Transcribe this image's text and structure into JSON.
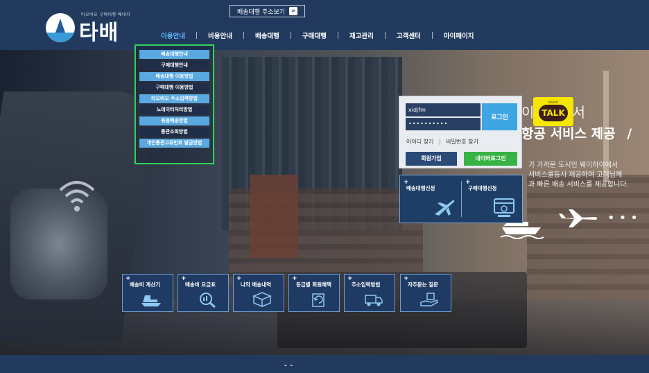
{
  "header": {
    "logo_tagline": "타오바오 구매대행 배대지",
    "logo_text": "타배",
    "address_button": "배송대행 주소보기",
    "nav": [
      "이용안내",
      "비용안내",
      "배송대행",
      "구매대행",
      "재고관리",
      "고객센터",
      "마이페이지"
    ]
  },
  "dropdown": {
    "items": [
      "배송대행안내",
      "구매대행안내",
      "배송대행 이용방법",
      "구매대행 이용방법",
      "타오바오 주소입력방법",
      "노데이터처리방법",
      "묶음배송방법",
      "통관조회방법",
      "개인통관고유번호 발급방법"
    ]
  },
  "kakao": {
    "small": "KAKAO",
    "label": "TALK",
    "color": "#f7e600"
  },
  "hero": {
    "line1": "이하이에서",
    "line2": "항공 서비스 제공",
    "line2_suffix": "/",
    "sub": [
      "가 가까운 도시인 웨이하이에서",
      "서비스를동시 제공하여 고객님께",
      "과 빠른 배송 서비스를 제공합니다."
    ]
  },
  "login": {
    "id_value": "xidjfm",
    "pw_value": "••••••••••",
    "login_button": "로그인",
    "find_id": "아이디 찾기",
    "separator": "|",
    "find_pw": "비밀번호 찾기",
    "join_button": "회원가입",
    "naver_button": "네이버로그인"
  },
  "service": {
    "shipping": "배송대행신청",
    "purchase": "구매대행신청"
  },
  "quick": [
    {
      "label": "배송비 계산기",
      "icon": "ship-icon"
    },
    {
      "label": "배송비 요금표",
      "icon": "magnifier-icon"
    },
    {
      "label": "나의 배송내역",
      "icon": "box-icon"
    },
    {
      "label": "등급별 회원혜택",
      "icon": "refresh-doc-icon"
    },
    {
      "label": "주소입력방법",
      "icon": "truck-icon"
    },
    {
      "label": "자주묻는 질문",
      "icon": "hand-box-icon"
    }
  ],
  "colors": {
    "header": "#223a5e",
    "active_nav": "#62b8ff",
    "dropdown_border": "#2fd35a",
    "login_button": "#3ea6e2",
    "join_button": "#2c4a78",
    "naver_button": "#37b346"
  }
}
